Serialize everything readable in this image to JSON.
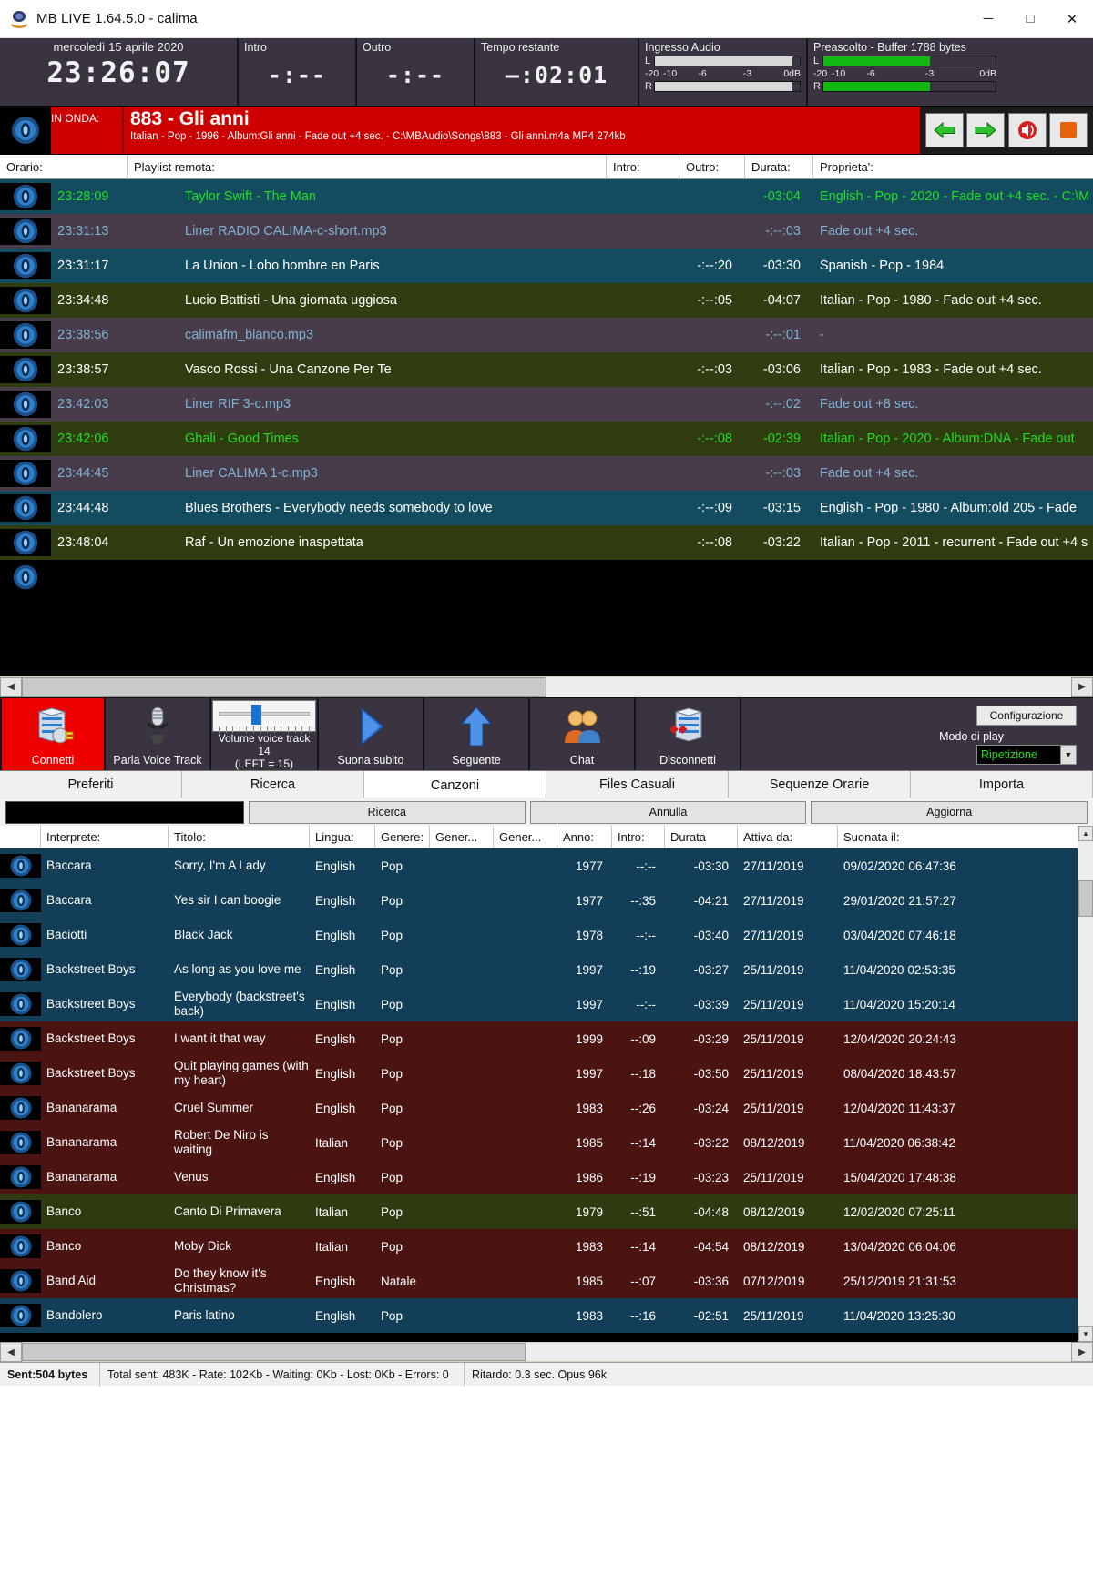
{
  "window": {
    "title": "MB LIVE 1.64.5.0  -  calima",
    "minimize": "─",
    "maximize": "□",
    "close": "✕"
  },
  "topbar": {
    "date": "mercoledì 15 aprile 2020",
    "clock": "23:26:07",
    "intro_label": "Intro",
    "intro_value": "-:--",
    "outro_label": "Outro",
    "outro_value": "-:--",
    "remaining_label": "Tempo restante",
    "remaining_value": "–:02:01",
    "audio_in_label": "Ingresso Audio",
    "preview_label": "Preascolto - Buffer 1788 bytes",
    "channel_left": "L",
    "channel_right": "R",
    "scale": [
      "-20",
      "-10",
      "-6",
      "-3",
      "0dB"
    ]
  },
  "onair": {
    "tag": "IN ONDA:",
    "title": "883 - Gli anni",
    "subtitle": "Italian - Pop - 1996 - Album:Gli anni - Fade out +4 sec. - C:\\MBAudio\\Songs\\883 - Gli anni.m4a MP4 274kb",
    "buttons": [
      "previous-green-arrow",
      "next-green-arrow",
      "speaker-red",
      "stop-orange"
    ]
  },
  "playlist": {
    "headers": [
      "Orario:",
      "Playlist remota:",
      "Intro:",
      "Outro:",
      "Durata:",
      "Proprieta':"
    ],
    "rows": [
      {
        "time": "23:28:09",
        "title": "Taylor Swift - The Man",
        "intro": "",
        "outro": "",
        "dur": "-03:04",
        "prop": "English - Pop - 2020 - Fade out +4 sec. - C:\\M",
        "style": "row-blue",
        "color": "txt-green"
      },
      {
        "time": "23:31:13",
        "title": "Liner RADIO CALIMA-c-short.mp3",
        "intro": "",
        "outro": "",
        "dur": "-:--:03",
        "prop": "Fade out +4 sec.",
        "style": "row-purple",
        "color": "txt-lblue"
      },
      {
        "time": "23:31:17",
        "title": "La Union - Lobo hombre en Paris",
        "intro": "",
        "outro": "-:--:20",
        "dur": "-03:30",
        "prop": "Spanish - Pop - 1984",
        "style": "row-blue",
        "color": "txt-white"
      },
      {
        "time": "23:34:48",
        "title": "Lucio Battisti - Una giornata uggiosa",
        "intro": "",
        "outro": "-:--:05",
        "dur": "-04:07",
        "prop": "Italian - Pop - 1980 - Fade out +4 sec.",
        "style": "row-olive",
        "color": "txt-white"
      },
      {
        "time": "23:38:56",
        "title": "calimafm_blanco.mp3",
        "intro": "",
        "outro": "",
        "dur": "-:--:01",
        "prop": "-",
        "style": "row-purple",
        "color": "txt-lblue"
      },
      {
        "time": "23:38:57",
        "title": "Vasco Rossi - Una Canzone Per Te",
        "intro": "",
        "outro": "-:--:03",
        "dur": "-03:06",
        "prop": "Italian - Pop - 1983 - Fade out +4 sec.",
        "style": "row-olive",
        "color": "txt-white"
      },
      {
        "time": "23:42:03",
        "title": "Liner RIF 3-c.mp3",
        "intro": "",
        "outro": "",
        "dur": "-:--:02",
        "prop": "Fade out +8 sec.",
        "style": "row-purple",
        "color": "txt-lblue"
      },
      {
        "time": "23:42:06",
        "title": "Ghali - Good Times",
        "intro": "",
        "outro": "-:--:08",
        "dur": "-02:39",
        "prop": "Italian - Pop - 2020 - Album:DNA - Fade out",
        "style": "row-olive",
        "color": "txt-green"
      },
      {
        "time": "23:44:45",
        "title": "Liner CALIMA 1-c.mp3",
        "intro": "",
        "outro": "",
        "dur": "-:--:03",
        "prop": "Fade out +4 sec.",
        "style": "row-purple",
        "color": "txt-lblue"
      },
      {
        "time": "23:44:48",
        "title": "Blues Brothers - Everybody needs somebody to love",
        "intro": "",
        "outro": "-:--:09",
        "dur": "-03:15",
        "prop": "English - Pop - 1980 - Album:old 205 - Fade",
        "style": "row-blue",
        "color": "txt-white"
      },
      {
        "time": "23:48:04",
        "title": "Raf - Un emozione inaspettata",
        "intro": "",
        "outro": "-:--:08",
        "dur": "-03:22",
        "prop": "Italian - Pop - 2011 - recurrent - Fade out +4 s",
        "style": "row-olive",
        "color": "txt-white"
      }
    ]
  },
  "toolbar": {
    "buttons": [
      {
        "label": "Connetti",
        "icon": "server-plug-icon"
      },
      {
        "label": "Parla Voice Track",
        "icon": "microphone-icon"
      },
      {
        "label": "Suona subito",
        "icon": "play-triangle-icon"
      },
      {
        "label": "Seguente",
        "icon": "up-arrow-icon"
      },
      {
        "label": "Chat",
        "icon": "people-icon"
      },
      {
        "label": "Disconnetti",
        "icon": "server-x-icon"
      }
    ],
    "slider_label_1": "Volume voice track 14",
    "slider_label_2": "(LEFT = 15)",
    "config_button": "Configurazione",
    "mode_label": "Modo di play",
    "mode_value": "Ripetizione"
  },
  "tabs": [
    {
      "label": "Preferiti",
      "active": false
    },
    {
      "label": "Ricerca",
      "active": false
    },
    {
      "label": "Canzoni",
      "active": true
    },
    {
      "label": "Files Casuali",
      "active": false
    },
    {
      "label": "Sequenze Orarie",
      "active": false
    },
    {
      "label": "Importa",
      "active": false
    }
  ],
  "search": {
    "value": "",
    "placeholder": "",
    "btn_search": "Ricerca",
    "btn_cancel": "Annulla",
    "btn_update": "Aggiorna"
  },
  "songs": {
    "headers": [
      "Interprete:",
      "Titolo:",
      "Lingua:",
      "Genere:",
      "Gener...",
      "Gener...",
      "Anno:",
      "Intro:",
      "Durata",
      "Attiva da:",
      "Suonata il:"
    ],
    "rows": [
      {
        "artist": "Baccara",
        "title": "Sorry, I'm A Lady",
        "lang": "English",
        "genre": "Pop",
        "g2": "",
        "g3": "",
        "year": "1977",
        "intro": "--:--",
        "dur": "-03:30",
        "from": "27/11/2019",
        "played": "09/02/2020 06:47:36",
        "style": "sr-blue"
      },
      {
        "artist": "Baccara",
        "title": "Yes sir I can boogie",
        "lang": "English",
        "genre": "Pop",
        "g2": "",
        "g3": "",
        "year": "1977",
        "intro": "--:35",
        "dur": "-04:21",
        "from": "27/11/2019",
        "played": "29/01/2020 21:57:27",
        "style": "sr-blue"
      },
      {
        "artist": "Baciotti",
        "title": "Black Jack",
        "lang": "English",
        "genre": "Pop",
        "g2": "",
        "g3": "",
        "year": "1978",
        "intro": "--:--",
        "dur": "-03:40",
        "from": "27/11/2019",
        "played": "03/04/2020 07:46:18",
        "style": "sr-blue"
      },
      {
        "artist": "Backstreet Boys",
        "title": "As long as you love me",
        "lang": "English",
        "genre": "Pop",
        "g2": "",
        "g3": "",
        "year": "1997",
        "intro": "--:19",
        "dur": "-03:27",
        "from": "25/11/2019",
        "played": "11/04/2020 02:53:35",
        "style": "sr-blue"
      },
      {
        "artist": "Backstreet Boys",
        "title": "Everybody (backstreet's back)",
        "lang": "English",
        "genre": "Pop",
        "g2": "",
        "g3": "",
        "year": "1997",
        "intro": "--:--",
        "dur": "-03:39",
        "from": "25/11/2019",
        "played": "11/04/2020 15:20:14",
        "style": "sr-blue"
      },
      {
        "artist": "Backstreet Boys",
        "title": "I want it that way",
        "lang": "English",
        "genre": "Pop",
        "g2": "",
        "g3": "",
        "year": "1999",
        "intro": "--:09",
        "dur": "-03:29",
        "from": "25/11/2019",
        "played": "12/04/2020 20:24:43",
        "style": "sr-maroon"
      },
      {
        "artist": "Backstreet Boys",
        "title": "Quit playing games (with my heart)",
        "lang": "English",
        "genre": "Pop",
        "g2": "",
        "g3": "",
        "year": "1997",
        "intro": "--:18",
        "dur": "-03:50",
        "from": "25/11/2019",
        "played": "08/04/2020 18:43:57",
        "style": "sr-maroon"
      },
      {
        "artist": "Bananarama",
        "title": "Cruel Summer",
        "lang": "English",
        "genre": "Pop",
        "g2": "",
        "g3": "",
        "year": "1983",
        "intro": "--:26",
        "dur": "-03:24",
        "from": "25/11/2019",
        "played": "12/04/2020 11:43:37",
        "style": "sr-maroon"
      },
      {
        "artist": "Bananarama",
        "title": "Robert De Niro is waiting",
        "lang": "Italian",
        "genre": "Pop",
        "g2": "",
        "g3": "",
        "year": "1985",
        "intro": "--:14",
        "dur": "-03:22",
        "from": "08/12/2019",
        "played": "11/04/2020 06:38:42",
        "style": "sr-maroon"
      },
      {
        "artist": "Bananarama",
        "title": "Venus",
        "lang": "English",
        "genre": "Pop",
        "g2": "",
        "g3": "",
        "year": "1986",
        "intro": "--:19",
        "dur": "-03:23",
        "from": "25/11/2019",
        "played": "15/04/2020 17:48:38",
        "style": "sr-maroon"
      },
      {
        "artist": "Banco",
        "title": "Canto Di Primavera",
        "lang": "Italian",
        "genre": "Pop",
        "g2": "",
        "g3": "",
        "year": "1979",
        "intro": "--:51",
        "dur": "-04:48",
        "from": "08/12/2019",
        "played": "12/02/2020 07:25:11",
        "style": "sr-olive"
      },
      {
        "artist": "Banco",
        "title": "Moby Dick",
        "lang": "Italian",
        "genre": "Pop",
        "g2": "",
        "g3": "",
        "year": "1983",
        "intro": "--:14",
        "dur": "-04:54",
        "from": "08/12/2019",
        "played": "13/04/2020 06:04:06",
        "style": "sr-maroon"
      },
      {
        "artist": "Band Aid",
        "title": "Do they know it's Christmas?",
        "lang": "English",
        "genre": "Natale",
        "g2": "",
        "g3": "",
        "year": "1985",
        "intro": "--:07",
        "dur": "-03:36",
        "from": "07/12/2019",
        "played": "25/12/2019 21:31:53",
        "style": "sr-maroon"
      },
      {
        "artist": "Bandolero",
        "title": "Paris latino",
        "lang": "English",
        "genre": "Pop",
        "g2": "",
        "g3": "",
        "year": "1983",
        "intro": "--:16",
        "dur": "-02:51",
        "from": "25/11/2019",
        "played": "11/04/2020 13:25:30",
        "style": "sr-blue"
      }
    ]
  },
  "status": {
    "sent": "Sent:504 bytes",
    "total": "Total sent: 483K - Rate: 102Kb - Waiting: 0Kb - Lost: 0Kb - Errors: 0",
    "delay": "Ritardo: 0.3 sec. Opus 96k"
  },
  "colors": {
    "accent_red": "#cc0000",
    "connect_red": "#ef0000",
    "green_text": "#22dd22",
    "meter_green": "#12b712",
    "panel": "#3a3340"
  }
}
